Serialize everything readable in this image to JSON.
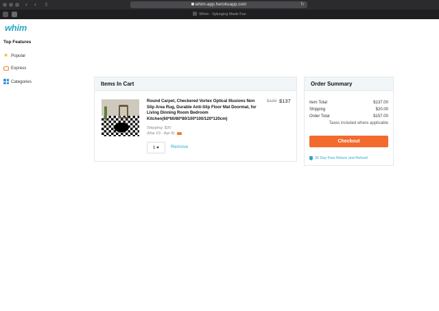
{
  "browser": {
    "url": "whim-app.herokuapp.com",
    "tab_title": "Whim - Splurging Made Fun"
  },
  "brand": {
    "logo": "whim",
    "accent": "#2aa9c9",
    "cta": "#f26a2e"
  },
  "sidebar": {
    "heading": "Top Features",
    "items": [
      {
        "label": "Popular",
        "icon": "star-icon"
      },
      {
        "label": "Express",
        "icon": "truck-icon"
      },
      {
        "label": "Categories",
        "icon": "grid-icon"
      }
    ]
  },
  "cart": {
    "title": "Items In Cart",
    "item": {
      "name": "Round Carpet, Checkered Vortex Optical Illusions Non Slip Area Rug, Durable Anti-Slip Floor Mat Doormat, for Living Dinning Room Bedroom Kitchen(60*60/80*80/100*100/120*120cm)",
      "original_price": "$139",
      "price": "$137",
      "shipping": "Shipping: $20",
      "delivery": "(Mar 23 - Apr 8)",
      "quantity": "1",
      "remove_label": "Remove"
    }
  },
  "summary": {
    "title": "Order Summary",
    "rows": [
      {
        "label": "Item Total",
        "value": "$137.00"
      },
      {
        "label": "Shipping",
        "value": "$20.00"
      },
      {
        "label": "Order Total",
        "value": "$157.00"
      }
    ],
    "taxes_note": "Taxes included where applicable",
    "checkout_label": "Checkout",
    "refund_label": "30 Day Free Return and Refund"
  }
}
